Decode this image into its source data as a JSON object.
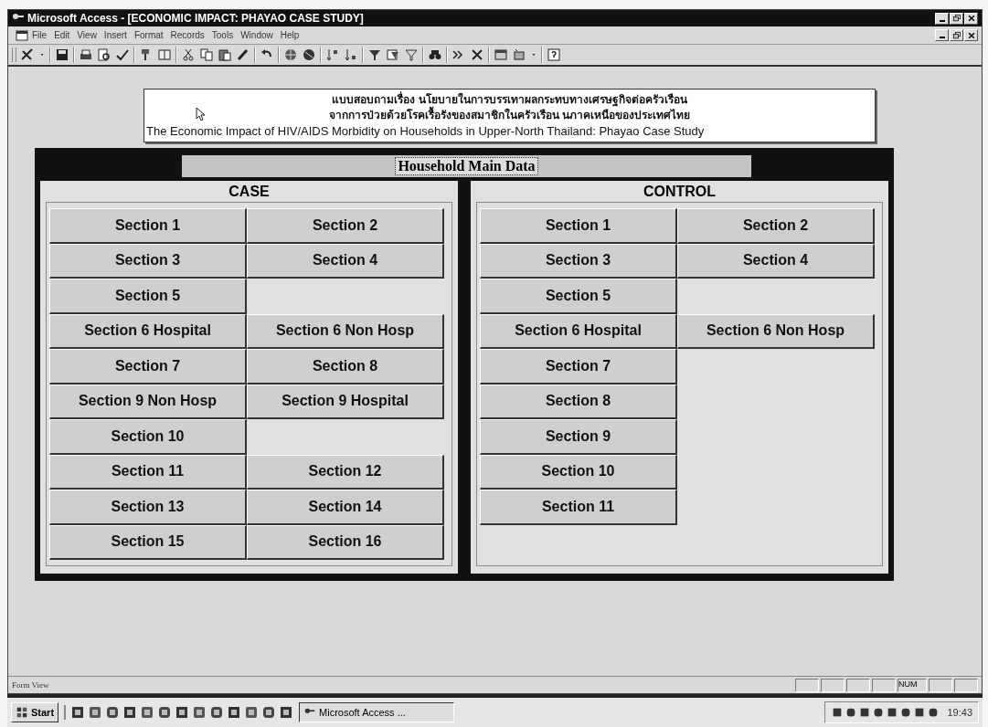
{
  "window": {
    "title": "Microsoft Access - [ECONOMIC IMPACT: PHAYAO CASE STUDY]"
  },
  "menu": [
    "File",
    "Edit",
    "View",
    "Insert",
    "Format",
    "Records",
    "Tools",
    "Window",
    "Help"
  ],
  "header": {
    "lines": [
      "แบบสอบถามเรื่อง นโยบายในการบรรเทาผลกระทบทางเศรษฐกิจต่อครัวเรือน",
      "จากการป่วยด้วยโรคเรื้อรังของสมาชิกในครัวเรือน นภาคเหนือของประเทศไทย",
      "The Economic Impact of HIV/AIDS Morbidity on Households in Upper-North Thailand: Phayao Case Study"
    ]
  },
  "form": {
    "title": "Household Main Data",
    "panels": [
      {
        "title": "CASE",
        "rows": [
          [
            "Section 1",
            "Section 2"
          ],
          [
            "Section 3",
            "Section 4"
          ],
          [
            "Section 5"
          ],
          [
            "Section 6 Hospital",
            "Section 6 Non Hosp"
          ],
          [
            "Section 7",
            "Section 8"
          ],
          [
            "Section 9 Non Hosp",
            "Section 9 Hospital"
          ],
          [
            "Section 10"
          ],
          [
            "Section 11",
            "Section 12"
          ],
          [
            "Section 13",
            "Section 14"
          ],
          [
            "Section 15",
            "Section 16"
          ]
        ]
      },
      {
        "title": "CONTROL",
        "rows": [
          [
            "Section 1",
            "Section 2"
          ],
          [
            "Section 3",
            "Section 4"
          ],
          [
            "Section 5"
          ],
          [
            "Section 6 Hospital",
            "Section 6 Non Hosp"
          ],
          [
            "Section 7"
          ],
          [
            "Section 8"
          ],
          [
            "Section 9"
          ],
          [
            "Section 10"
          ],
          [
            "Section 11"
          ]
        ]
      }
    ]
  },
  "status_bar": {
    "mode": "Form View",
    "indicator": "NUM"
  },
  "taskbar": {
    "start": "Start",
    "task": "Microsoft Access ...",
    "clock": "19:43"
  }
}
